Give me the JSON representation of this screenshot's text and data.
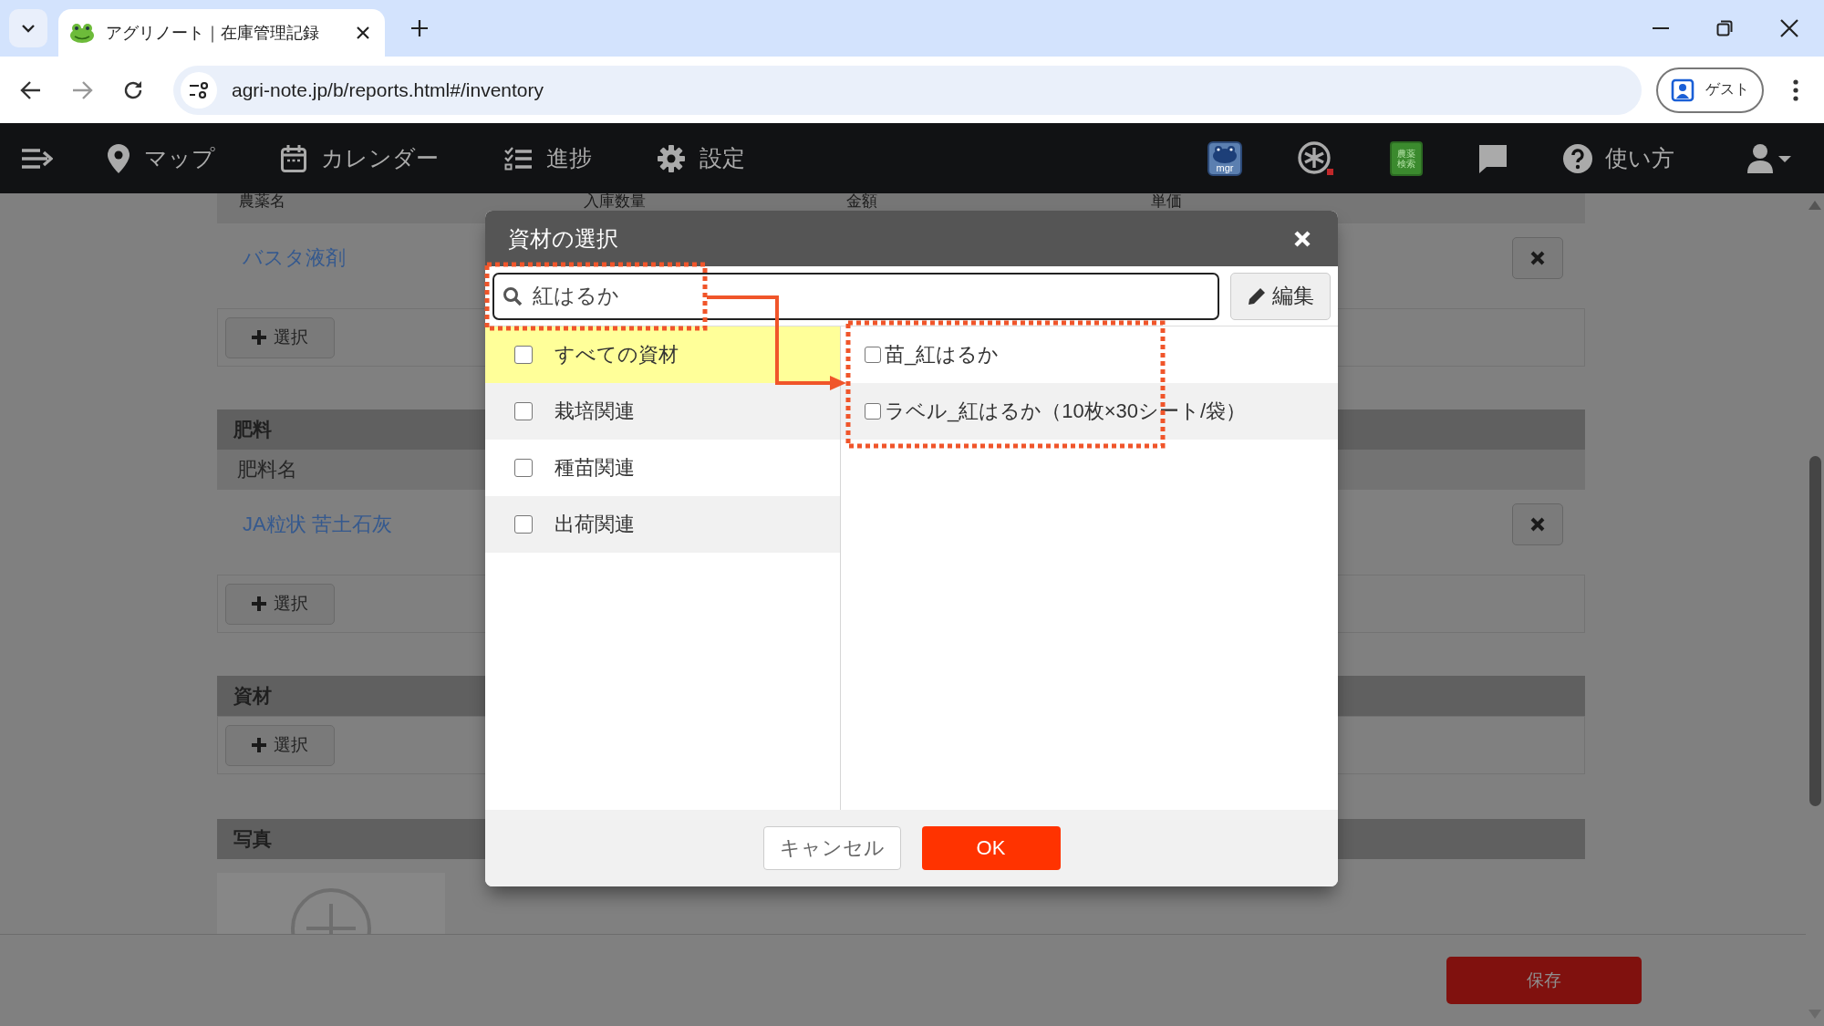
{
  "browser": {
    "tab_title": "アグリノート｜在庫管理記録",
    "url": "agri-note.jp/b/reports.html#/inventory",
    "profile_label": "ゲスト"
  },
  "nav": {
    "items": [
      {
        "kind": "map",
        "label": "マップ"
      },
      {
        "kind": "calendar",
        "label": "カレンダー"
      },
      {
        "kind": "progress",
        "label": "進捗"
      },
      {
        "kind": "settings",
        "label": "設定"
      }
    ],
    "tools": [
      {
        "kind": "mgr",
        "label": "mgr"
      },
      {
        "kind": "rice"
      },
      {
        "kind": "book",
        "lines": [
          "農薬",
          "検索"
        ]
      },
      {
        "kind": "chat"
      },
      {
        "kind": "help",
        "label": "使い方"
      },
      {
        "kind": "user"
      }
    ]
  },
  "page": {
    "pesticide_columns": [
      "農薬名",
      "入庫数量",
      "金額",
      "単価"
    ],
    "pesticide_rows": [
      "バスタ液剤"
    ],
    "select_button": "選択",
    "sections": [
      {
        "kind": "list",
        "title": "肥料",
        "column": "肥料名",
        "rows": [
          "JA粒状 苦土石灰"
        ],
        "select_button": "選択"
      },
      {
        "kind": "list",
        "title": "資材",
        "select_button": "選択"
      },
      {
        "kind": "photo",
        "title": "写真"
      }
    ],
    "save_button": "保存"
  },
  "dialog": {
    "title": "資材の選択",
    "search": {
      "value": "紅はるか"
    },
    "edit_button": "編集",
    "categories": [
      {
        "label": "すべての資材",
        "selected": true,
        "checked": false
      },
      {
        "label": "栽培関連",
        "selected": false,
        "checked": false
      },
      {
        "label": "種苗関連",
        "selected": false,
        "checked": false
      },
      {
        "label": "出荷関連",
        "selected": false,
        "checked": false
      }
    ],
    "items": [
      {
        "label": "苗_紅はるか",
        "checked": false
      },
      {
        "label": "ラベル_紅はるか（10枚×30シート/袋）",
        "checked": false
      }
    ],
    "cancel_button": "キャンセル",
    "ok_button": "OK"
  }
}
